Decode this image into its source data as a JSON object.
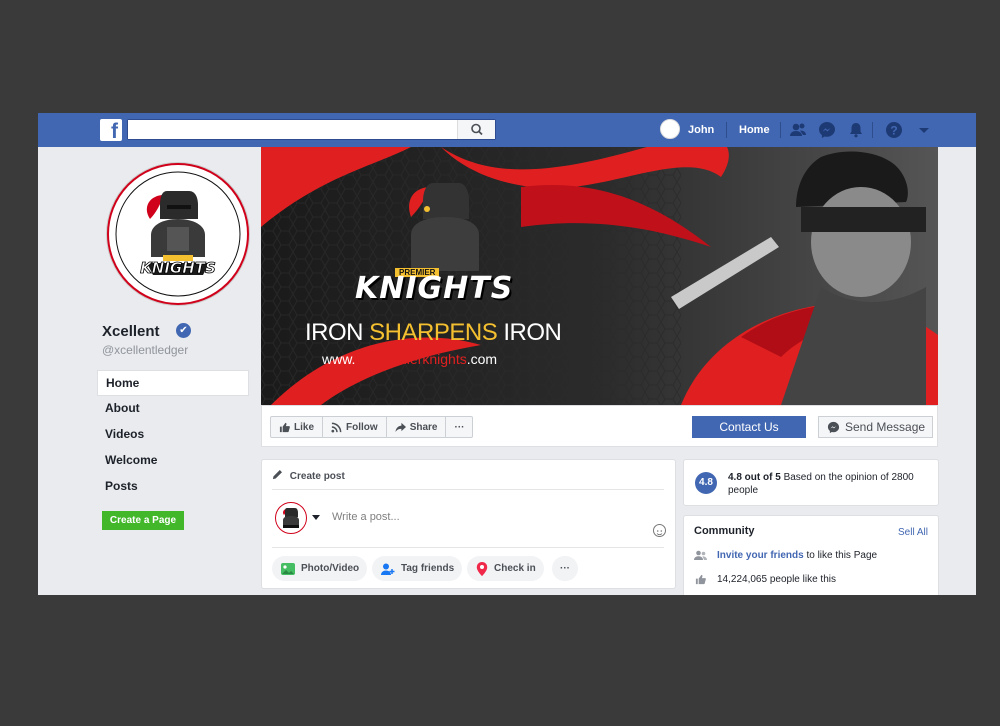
{
  "topbar": {
    "logo_letter": "f",
    "search_placeholder": "",
    "user_name": "John",
    "home_label": "Home"
  },
  "page": {
    "name": "Xcellent",
    "handle": "@xcellentledger",
    "verified_mark": "✔",
    "create_page_label": "Create a Page"
  },
  "sidebar": {
    "items": [
      {
        "label": "Home",
        "active": true
      },
      {
        "label": "About"
      },
      {
        "label": "Videos"
      },
      {
        "label": "Welcome"
      },
      {
        "label": "Posts"
      }
    ]
  },
  "cover": {
    "brand_top": "PREMIER",
    "brand_main": "KNIGHTS",
    "tagline_part1": "IRON ",
    "tagline_highlight": "SHARPENS",
    "tagline_part2": " IRON",
    "website_prefix": "www.",
    "website_highlight": "thepremierknights",
    "website_suffix": ".com",
    "colors": {
      "red": "#e02020",
      "gold": "#f5c030",
      "dark": "#151515"
    }
  },
  "actions": {
    "like": "Like",
    "follow": "Follow",
    "share": "Share",
    "more": "···",
    "contact": "Contact Us",
    "send_message": "Send Message"
  },
  "create_post": {
    "title": "Create post",
    "placeholder": "Write a post...",
    "photo_video": "Photo/Video",
    "tag_friends": "Tag friends",
    "check_in": "Check in",
    "more": "···"
  },
  "rating": {
    "score": "4.8",
    "strong": "4.8 out of 5",
    "rest": "Based  on the opinion of 2800 people"
  },
  "community": {
    "title": "Community",
    "see_all": "Sell All",
    "invite_link": "Invite your friends",
    "invite_rest": "to like this Page",
    "likes_text": "14,224,065 people like this"
  },
  "theme": {
    "facebook_blue": "#4267b2",
    "green": "#42b72a"
  }
}
